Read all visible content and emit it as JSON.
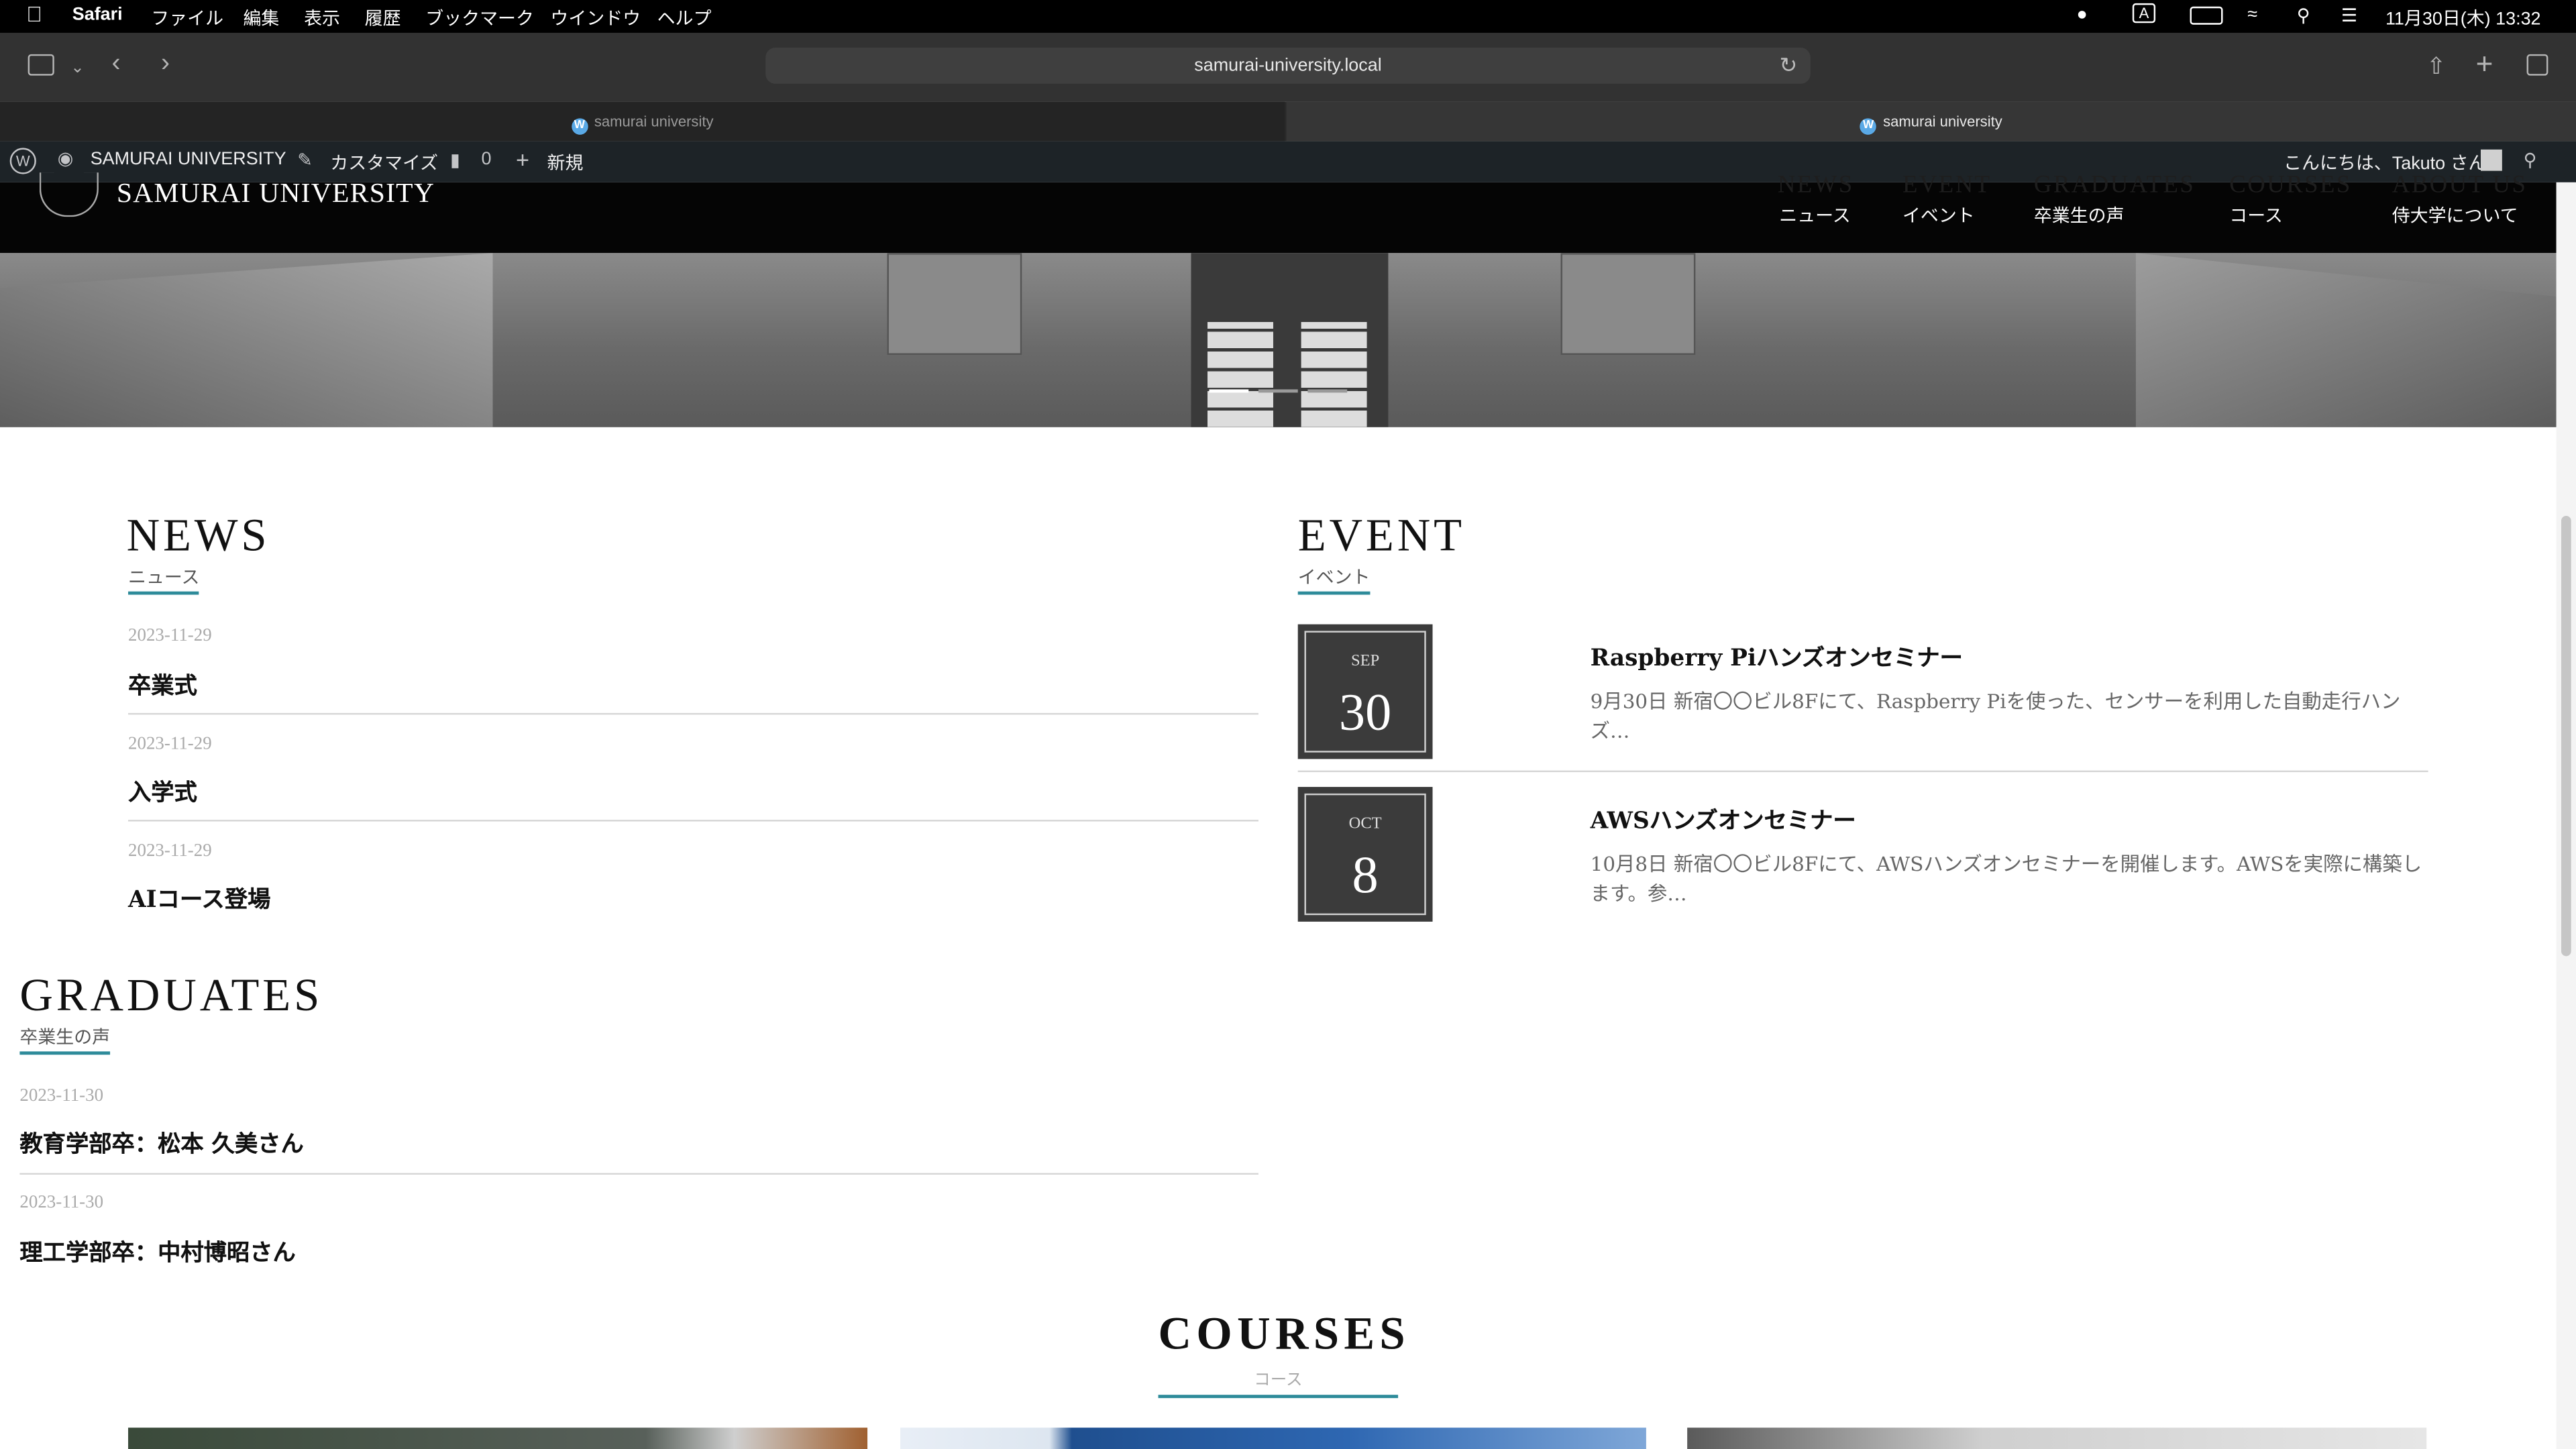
{
  "menubar": {
    "app": "Safari",
    "items": [
      "ファイル",
      "編集",
      "表示",
      "履歴",
      "ブックマーク",
      "ウインドウ",
      "ヘルプ"
    ],
    "datetime": "11月30日(木) 13:32",
    "input_indicator": "A"
  },
  "browser": {
    "url": "samurai-university.local",
    "tabs": [
      {
        "label": "samurai university",
        "active": false
      },
      {
        "label": "samurai university",
        "active": true
      }
    ]
  },
  "adminbar": {
    "site_name": "SAMURAI UNIVERSITY",
    "customize": "カスタマイズ",
    "comments_count": "0",
    "new_label": "新規",
    "greeting": "こんにちは、Takuto さん"
  },
  "site": {
    "logo_text": "SAMURAI UNIVERSITY",
    "nav": [
      {
        "en": "NEWS",
        "jp": "ニュース"
      },
      {
        "en": "EVENT",
        "jp": "イベント"
      },
      {
        "en": "GRADUATES",
        "jp": "卒業生の声"
      },
      {
        "en": "COURSES",
        "jp": "コース"
      },
      {
        "en": "ABOUT US",
        "jp": "侍大学について"
      }
    ]
  },
  "news": {
    "title": "NEWS",
    "subtitle": "ニュース",
    "items": [
      {
        "date": "2023-11-29",
        "title": "卒業式"
      },
      {
        "date": "2023-11-29",
        "title": "入学式"
      },
      {
        "date": "2023-11-29",
        "title": "AIコース登場"
      }
    ]
  },
  "event": {
    "title": "EVENT",
    "subtitle": "イベント",
    "items": [
      {
        "month": "SEP",
        "day": "30",
        "title": "Raspberry Piハンズオンセミナー",
        "desc": "9月30日 新宿〇〇ビル8Fにて、Raspberry Piを使った、センサーを利用した自動走行ハンズ…"
      },
      {
        "month": "OCT",
        "day": "8",
        "title": "AWSハンズオンセミナー",
        "desc": "10月8日 新宿〇〇ビル8Fにて、AWSハンズオンセミナーを開催します。AWSを実際に構築します。参…"
      }
    ]
  },
  "graduates": {
    "title": "GRADUATES",
    "subtitle": "卒業生の声",
    "items": [
      {
        "date": "2023-11-30",
        "title": "教育学部卒：松本 久美さん"
      },
      {
        "date": "2023-11-30",
        "title": "理工学部卒：中村博昭さん"
      }
    ]
  },
  "courses": {
    "title": "COURSES",
    "subtitle": "コース"
  },
  "colors": {
    "accent": "#2e8b9a",
    "admin_bar": "#1d2327",
    "header": "#050505"
  }
}
